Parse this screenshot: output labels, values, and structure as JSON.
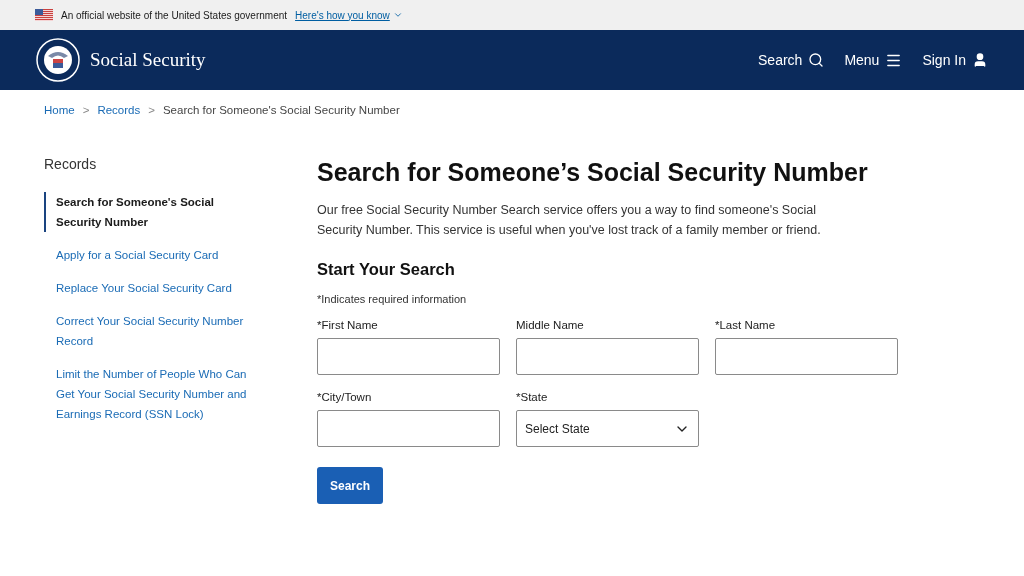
{
  "gov_banner": {
    "text": "An official website of the United States government",
    "link": "Here's how you know"
  },
  "header": {
    "site_name": "Social Security",
    "nav": [
      {
        "label": "Search"
      },
      {
        "label": "Menu"
      },
      {
        "label": "Sign In"
      }
    ]
  },
  "breadcrumb": [
    {
      "label": "Home",
      "link": true,
      "separator": ">"
    },
    {
      "label": "Records",
      "link": true,
      "separator": ">"
    },
    {
      "label": "Search for Someone's Social Security Number",
      "link": false
    }
  ],
  "sidebar": {
    "title": "Records",
    "items": [
      {
        "label": "Search for Someone's Social Security Number",
        "selected": true
      },
      {
        "label": "Apply for a Social Security Card",
        "selected": false
      },
      {
        "label": "Replace Your Social Security Card",
        "selected": false
      },
      {
        "label": "Correct Your Social Security Number Record",
        "selected": false
      },
      {
        "label": "Limit the Number of People Who Can Get Your Social Security Number and Earnings Record (SSN Lock)",
        "selected": false
      }
    ]
  },
  "main": {
    "title": "Search for Someone’s Social Security Number",
    "intro": "Our free Social Security Number Search service offers you a way to find someone's Social Security Number. This service is useful when you've lost track of a family member or friend.",
    "form_title": "Start Your Search",
    "required_note": "*Indicates required information",
    "fields": [
      {
        "label": "*First Name",
        "kind": "text"
      },
      {
        "label": "Middle Name",
        "kind": "text"
      },
      {
        "label": "*Last Name",
        "kind": "text"
      },
      {
        "label": "*City/Town",
        "kind": "text"
      },
      {
        "label": "*State",
        "kind": "select",
        "value": "Select State"
      }
    ],
    "button": "Search"
  }
}
